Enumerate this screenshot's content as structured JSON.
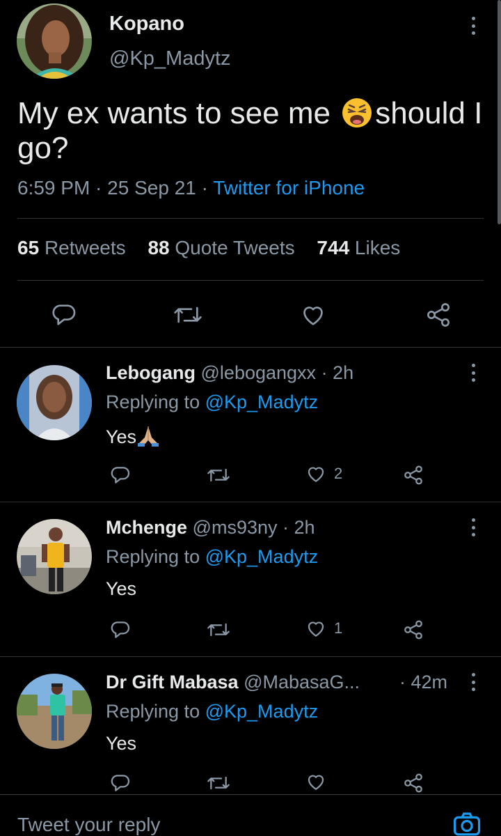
{
  "main_tweet": {
    "name": "Kopano",
    "handle": "@Kp_Madytz",
    "text_before": "My ex wants to see me",
    "emoji": "weary-face-emoji",
    "text_after": "should I go?",
    "time": "6:59 PM",
    "date": "25 Sep 21",
    "source": "Twitter for iPhone",
    "stats": [
      {
        "count": "65",
        "label": "Retweets"
      },
      {
        "count": "88",
        "label": "Quote Tweets"
      },
      {
        "count": "744",
        "label": "Likes"
      }
    ]
  },
  "replies": [
    {
      "name": "Lebogang",
      "handle": "@lebogangxx",
      "time": "· 2h",
      "replying_prefix": "Replying to",
      "replying_to": "@Kp_Madytz",
      "text": "Yes",
      "emoji": "folded-hands-emoji",
      "likes": "2"
    },
    {
      "name": "Mchenge",
      "handle": "@ms93ny",
      "time": "· 2h",
      "replying_prefix": "Replying to",
      "replying_to": "@Kp_Madytz",
      "text": "Yes",
      "likes": "1"
    },
    {
      "name": "Dr Gift Mabasa",
      "handle": "@MabasaG...",
      "time": "· 42m",
      "replying_prefix": "Replying to",
      "replying_to": "@Kp_Madytz",
      "text": "Yes",
      "likes": ""
    }
  ],
  "compose": {
    "placeholder": "Tweet your reply"
  },
  "colors": {
    "background": "#000000",
    "text": "#e7e9ea",
    "secondary": "#8b98a5",
    "link": "#1d9bf0",
    "divider": "#2f3336"
  }
}
